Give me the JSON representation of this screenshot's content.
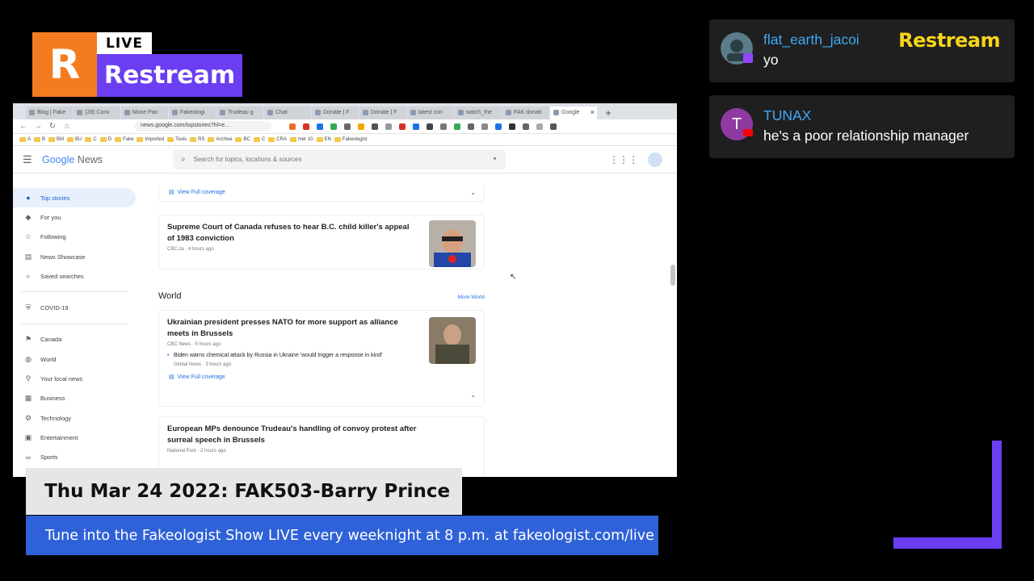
{
  "logo": {
    "letter": "R",
    "live": "LIVE",
    "name": "Restream"
  },
  "browser": {
    "tabs": [
      {
        "label": "Blog | Fake"
      },
      {
        "label": "(28) Conv"
      },
      {
        "label": "Mose Pan"
      },
      {
        "label": "Fakeologi"
      },
      {
        "label": "Trudeau g"
      },
      {
        "label": "Chat"
      },
      {
        "label": "Donate | F"
      },
      {
        "label": "Donate | F"
      },
      {
        "label": "latest con"
      },
      {
        "label": "watch_the"
      },
      {
        "label": "FAK donati"
      },
      {
        "label": "Google"
      }
    ],
    "url": "news.google.com/topstories?hl=e...",
    "bookmarks": [
      "A",
      "B",
      "BM",
      "BU",
      "C",
      "D",
      "Fake",
      "Imported",
      "Tools",
      "RS",
      "Archive",
      "BC",
      "C",
      "CRA",
      "mer 10",
      "EN",
      "Fakeologist"
    ]
  },
  "gnews": {
    "logo_google": "Google",
    "logo_news": "News",
    "search_placeholder": "Search for topics, locations & sources",
    "sidebar": {
      "top_stories": "Top stories",
      "for_you": "For you",
      "following": "Following",
      "news_showcase": "News Showcase",
      "saved_searches": "Saved searches",
      "covid": "COVID-19",
      "canada": "Canada",
      "world": "World",
      "local_news": "Your local news",
      "business": "Business",
      "technology": "Technology",
      "entertainment": "Entertainment",
      "sports": "Sports"
    },
    "feed": {
      "coverage_top": "View Full coverage",
      "story1": {
        "headline": "Supreme Court of Canada refuses to hear B.C. child killer's appeal of 1983 conviction",
        "meta": "CBC.ca · 4 hours ago"
      },
      "world_title": "World",
      "more_world": "More World",
      "story2": {
        "headline": "Ukrainian president presses NATO for more support as alliance meets in Brussels",
        "meta": "CBC News · 5 hours ago",
        "sub": "Biden warns chemical attack by Russia in Ukraine 'would trigger a response in kind'",
        "sub_meta": "Global News · 3 hours ago",
        "coverage": "View Full coverage"
      },
      "story3": {
        "headline": "European MPs denounce Trudeau's handling of convoy protest after surreal speech in Brussels",
        "meta": "National Post · 2 hours ago"
      }
    }
  },
  "chat": [
    {
      "name": "flat_earth_jacoi",
      "message": "yo",
      "platform": "twitch-icon"
    },
    {
      "name": "TUNAX",
      "message": "he's a poor relationship manager",
      "platform": "youtube-icon",
      "avatar_letter": "T"
    }
  ],
  "chat_brand": "Restream",
  "lower_third": {
    "title": "Thu Mar 24 2022: FAK503-Barry Prince",
    "ticker": "Tune into the Fakeologist Show LIVE every weeknight at 8 p.m. at fakeologist.com/live"
  },
  "colors": {
    "accent_orange": "#f47c20",
    "accent_purple": "#6b3ef2",
    "ticker_blue": "#2f62d8",
    "chat_name_blue": "#3fa9f5",
    "chat_brand_yellow": "#f7d51a"
  }
}
